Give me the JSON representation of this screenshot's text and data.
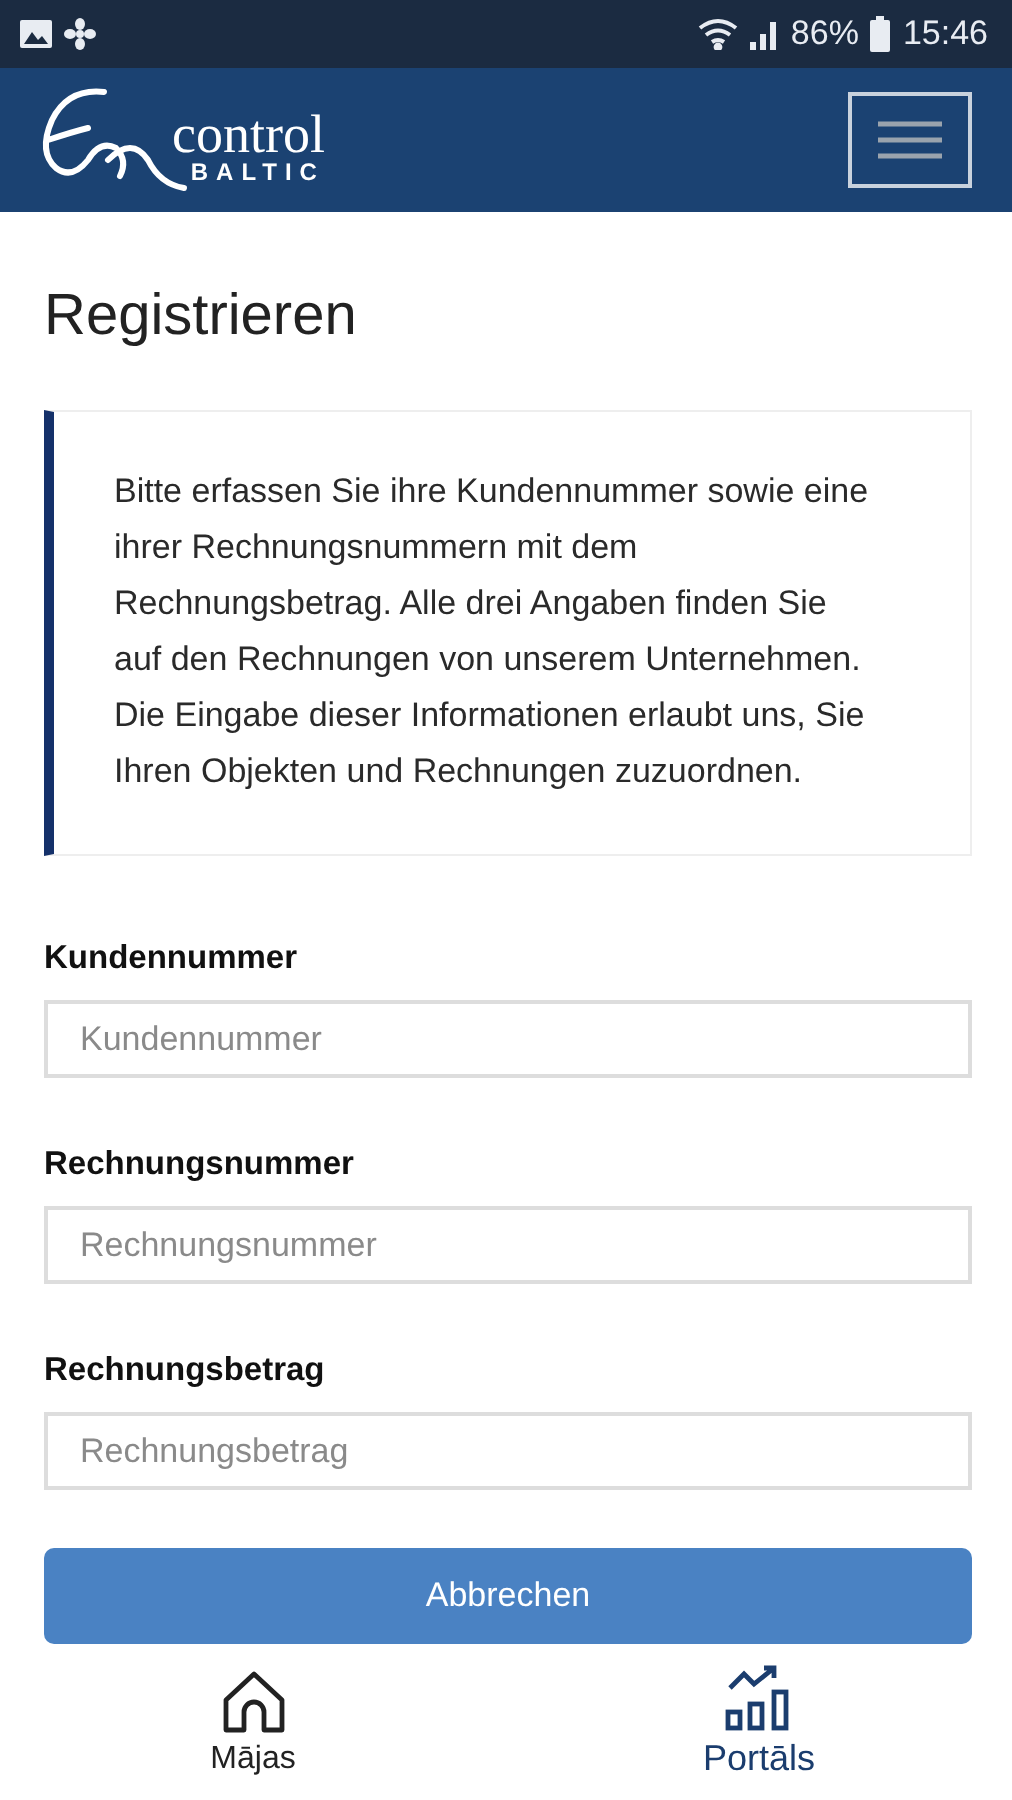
{
  "status_bar": {
    "battery": "86%",
    "time": "15:46"
  },
  "header": {
    "logo_word": "control",
    "logo_sub": "BALTIC"
  },
  "title": "Registrieren",
  "info": "Bitte erfassen Sie ihre Kundennummer sowie eine ihrer Rechnungsnummern mit dem Rechnungsbetrag. Alle drei Angaben finden Sie auf den Rechnungen von unserem Unternehmen. Die Eingabe dieser Informationen erlaubt uns, Sie Ihren Objekten und Rechnungen zuzuordnen.",
  "fields": [
    {
      "label": "Kundennummer",
      "placeholder": "Kundennummer"
    },
    {
      "label": "Rechnungsnummer",
      "placeholder": "Rechnungsnummer"
    },
    {
      "label": "Rechnungsbetrag",
      "placeholder": "Rechnungsbetrag"
    }
  ],
  "button": "Abbrechen",
  "nav": [
    {
      "label": "Mājas",
      "kind": "home",
      "selected": false
    },
    {
      "label": "Portāls",
      "kind": "chart",
      "selected": true
    }
  ]
}
